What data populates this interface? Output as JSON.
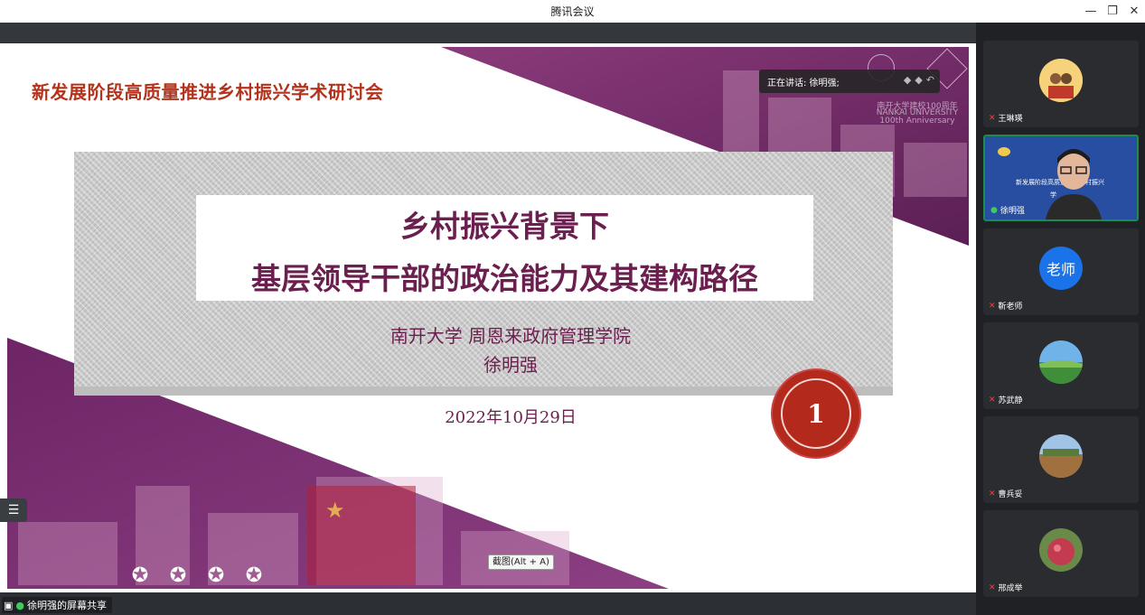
{
  "window": {
    "title": "腾讯会议",
    "controls": {
      "minimize": "—",
      "restore": "❐",
      "close": "✕"
    }
  },
  "slide": {
    "conference_title": "新发展阶段高质量推进乡村振兴学术研讨会",
    "title_line1": "乡村振兴背景下",
    "title_line2": "基层领导干部的政治能力及其建构路径",
    "affiliation": "南开大学  周恩来政府管理学院",
    "author": "徐明强",
    "date": "2022年10月29日",
    "badge_number": "1",
    "logo_text": "南开大学建校100周年",
    "logo_subtext": "NANKAI UNIVERSITY",
    "logo_subtext2": "100th Anniversary",
    "stars": [
      "✪",
      "✪",
      "✪",
      "✪"
    ],
    "colors": {
      "accent": "#6b1f4e",
      "title_red": "#b3331c",
      "badge": "#b3291b"
    }
  },
  "speaking": {
    "label": "正在讲话: 徐明强;"
  },
  "tooltip": {
    "text": "截图(Alt + A)"
  },
  "share": {
    "label": "徐明强的屏幕共享"
  },
  "participants": [
    {
      "name": "王琳瑛",
      "mic": "off",
      "avatar": "photo",
      "active": false
    },
    {
      "name": "徐明强",
      "mic": "on",
      "avatar": "video",
      "active": true
    },
    {
      "name": "靳老师",
      "mic": "off",
      "avatar": "text",
      "avatar_text": "老师",
      "active": false
    },
    {
      "name": "苏武静",
      "mic": "off",
      "avatar": "photo",
      "active": false
    },
    {
      "name": "曹兵妥",
      "mic": "off",
      "avatar": "photo",
      "active": false
    },
    {
      "name": "邢成举",
      "mic": "off",
      "avatar": "photo",
      "active": false
    }
  ],
  "video_overlay": {
    "line1": "新发展阶段高质量推进乡村振兴",
    "line2": "学"
  }
}
